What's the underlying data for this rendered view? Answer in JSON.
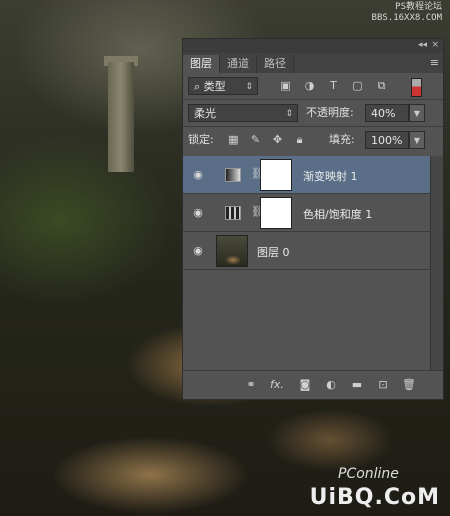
{
  "watermark": {
    "top_line1": "PS教程论坛",
    "top_line2": "BBS.16XX8.COM",
    "pconline": "PConline",
    "bottom": "UiBQ.CoM"
  },
  "panel": {
    "tabs": [
      "图层",
      "通道",
      "路径"
    ],
    "active_tab": "图层",
    "collapse_label": "◂◂",
    "close_label": "×",
    "menu_label": "≡",
    "filter": {
      "kind_label": "类型",
      "icons": [
        "image-filter-icon",
        "adjustment-filter-icon",
        "type-filter-icon",
        "shape-filter-icon",
        "smart-object-filter-icon"
      ]
    },
    "blend_mode": "柔光",
    "opacity_label": "不透明度:",
    "opacity_value": "40%",
    "lock_label": "锁定:",
    "fill_label": "填充:",
    "fill_value": "100%",
    "layers": [
      {
        "name": "渐变映射 1",
        "type": "gradient-map",
        "selected": true,
        "visible": true
      },
      {
        "name": "色相/饱和度 1",
        "type": "hue-saturation",
        "selected": false,
        "visible": true
      },
      {
        "name": "图层 0",
        "type": "pixel",
        "selected": false,
        "visible": true
      }
    ],
    "footer_icons": [
      "link-icon",
      "fx-icon",
      "mask-icon",
      "adjustment-icon",
      "folder-icon",
      "new-layer-icon",
      "trash-icon"
    ],
    "fx_label": "fx."
  }
}
